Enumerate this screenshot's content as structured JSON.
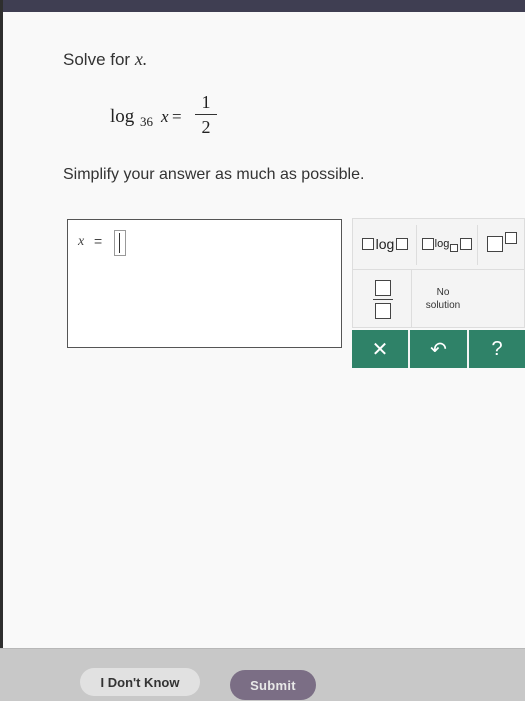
{
  "question": {
    "prompt_text": "Solve for ",
    "prompt_var": "x.",
    "equation": {
      "log": "log",
      "base": "36",
      "var": "x",
      "equals": "=",
      "numerator": "1",
      "denominator": "2"
    },
    "instruction": "Simplify your answer as much as possible."
  },
  "answer": {
    "var": "x",
    "equals": "="
  },
  "palette": {
    "log_label": "log",
    "log_base_label": "log",
    "no_solution_line1": "No",
    "no_solution_line2": "solution",
    "clear_symbol": "✕",
    "undo_symbol": "↶",
    "help_symbol": "?"
  },
  "footer": {
    "dont_know_label": "I Don't Know",
    "submit_label": "Submit"
  },
  "colors": {
    "palette_action_bg": "#2f8268",
    "submit_bg": "#7b6e85"
  }
}
